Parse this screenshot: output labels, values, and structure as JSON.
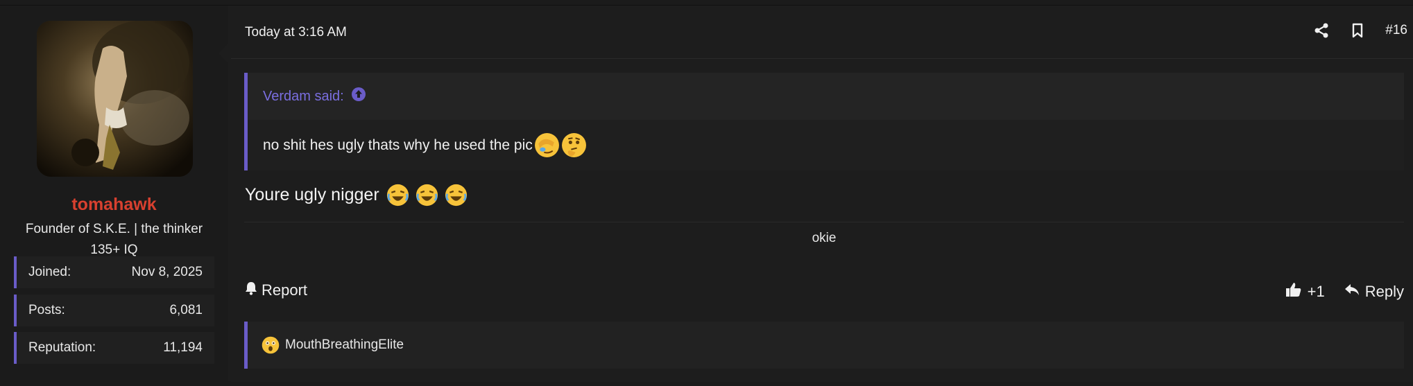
{
  "user": {
    "username": "tomahawk",
    "title": "Founder of S.K.E. | the thinker 135+ IQ",
    "stats": [
      {
        "label": "Joined:",
        "value": "Nov 8, 2025"
      },
      {
        "label": "Posts:",
        "value": "6,081"
      },
      {
        "label": "Reputation:",
        "value": "11,194"
      }
    ]
  },
  "post": {
    "timestamp": "Today at 3:16 AM",
    "number": "#16",
    "quote": {
      "author": "Verdam said:",
      "text": "no shit hes ugly thats why he used the pic"
    },
    "body": "Youre ugly nigger",
    "signature": "okie",
    "footer": {
      "report_label": "Report",
      "like_count": "+1",
      "reply_label": "Reply"
    },
    "reactions": {
      "user": "MouthBreathingElite"
    }
  },
  "colors": {
    "accent": "#6a5cc8",
    "username": "#d8402f",
    "quote_author": "#7a6ee0",
    "background": "#1d1d1d"
  },
  "icons": [
    "share-icon",
    "bookmark-icon",
    "arrow-up-circle-icon",
    "bell-icon",
    "thumbs-up-icon",
    "reply-arrow-icon",
    "facepalm-emoji",
    "thinking-emoji",
    "crying-laughing-emoji",
    "astonished-emoji"
  ]
}
